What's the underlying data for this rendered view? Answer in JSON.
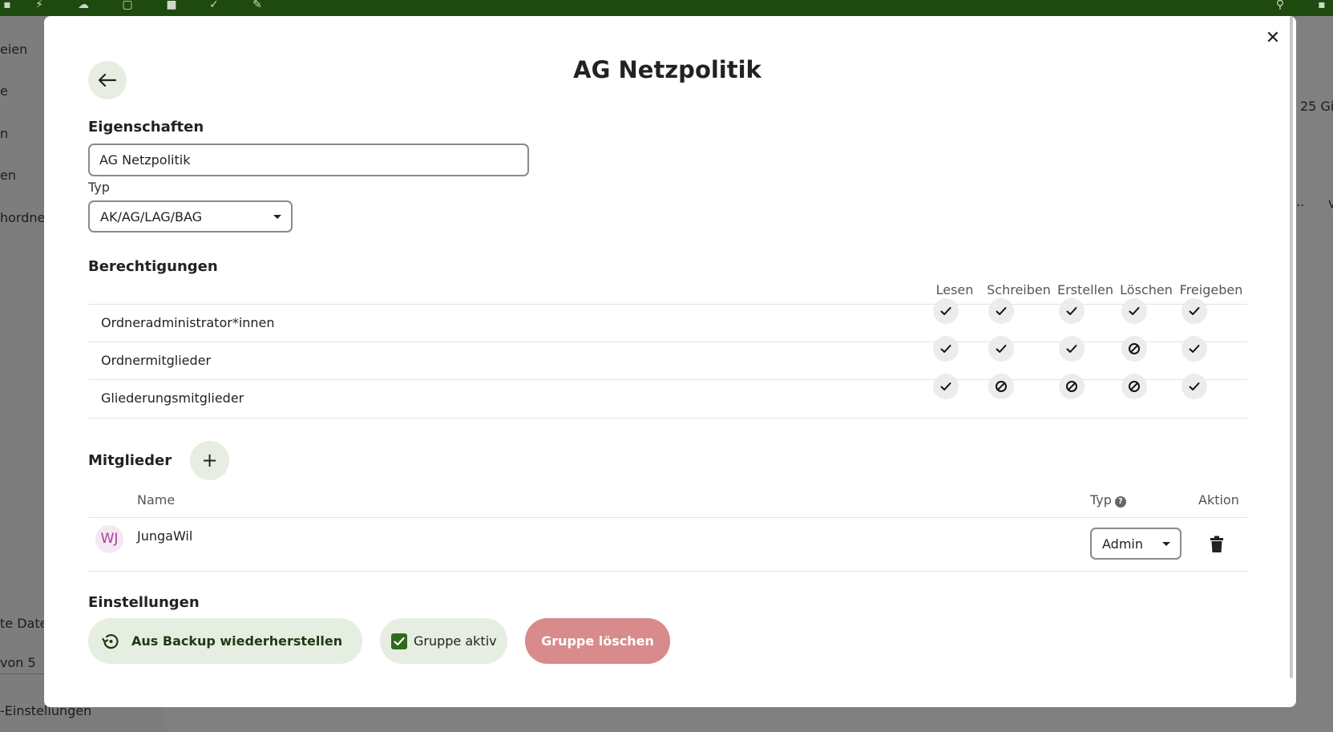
{
  "background": {
    "nav_items": [
      "eien",
      "e",
      "n",
      "en",
      "hordne",
      "te Date",
      "von 5",
      "-Einstellungen"
    ],
    "right_fragments": [
      "25 Gi",
      "...",
      "v"
    ]
  },
  "modal": {
    "title": "AG Netzpolitik",
    "properties": {
      "heading": "Eigenschaften",
      "name_value": "AG Netzpolitik",
      "type_label": "Typ",
      "type_value": "AK/AG/LAG/BAG"
    },
    "permissions": {
      "heading": "Berechtigungen",
      "columns": [
        "Lesen",
        "Schreiben",
        "Erstellen",
        "Löschen",
        "Freigeben"
      ],
      "rows": [
        {
          "label": "Ordneradministrator*innen",
          "values": [
            true,
            true,
            true,
            true,
            true
          ]
        },
        {
          "label": "Ordnermitglieder",
          "values": [
            true,
            true,
            true,
            false,
            true
          ]
        },
        {
          "label": "Gliederungsmitglieder",
          "values": [
            true,
            false,
            false,
            false,
            true
          ]
        }
      ]
    },
    "members": {
      "heading": "Mitglieder",
      "add_label": "+",
      "col_name": "Name",
      "col_type": "Typ",
      "col_action": "Aktion",
      "help_icon": "question-icon",
      "rows": [
        {
          "initials": "WJ",
          "name": "JungaWil",
          "type": "Admin"
        }
      ]
    },
    "settings": {
      "heading": "Einstellungen",
      "restore_label": "Aus Backup wiederherstellen",
      "active_label": "Gruppe aktiv",
      "active_checked": true,
      "delete_label": "Gruppe löschen"
    }
  },
  "colors": {
    "topbar": "#1f4a0f",
    "accent_light": "#e6eee2",
    "checkbox": "#2f6b1e",
    "danger": "#d98a8a",
    "avatar_text": "#a0449a"
  }
}
